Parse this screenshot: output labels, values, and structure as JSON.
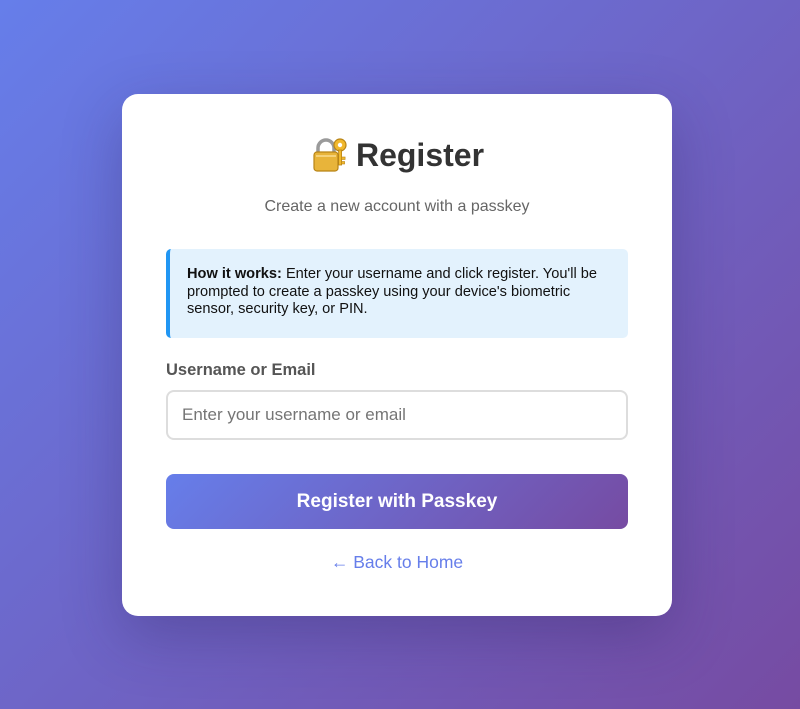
{
  "header": {
    "icon": "locked-with-key-icon",
    "title": "Register",
    "subtitle": "Create a new account with a passkey"
  },
  "info": {
    "heading": "How it works:",
    "body": "Enter your username and click register. You'll be prompted to create a passkey using your device's biometric sensor, security key, or PIN."
  },
  "form": {
    "username_label": "Username or Email",
    "username_value": "",
    "username_placeholder": "Enter your username or email",
    "submit_label": "Register with Passkey"
  },
  "footer": {
    "back_link": "← Back to Home"
  },
  "colors": {
    "gradient_start": "#667eea",
    "gradient_end": "#764ba2",
    "info_background": "#e3f2fd",
    "info_accent": "#2196f3",
    "link": "#667eea"
  }
}
